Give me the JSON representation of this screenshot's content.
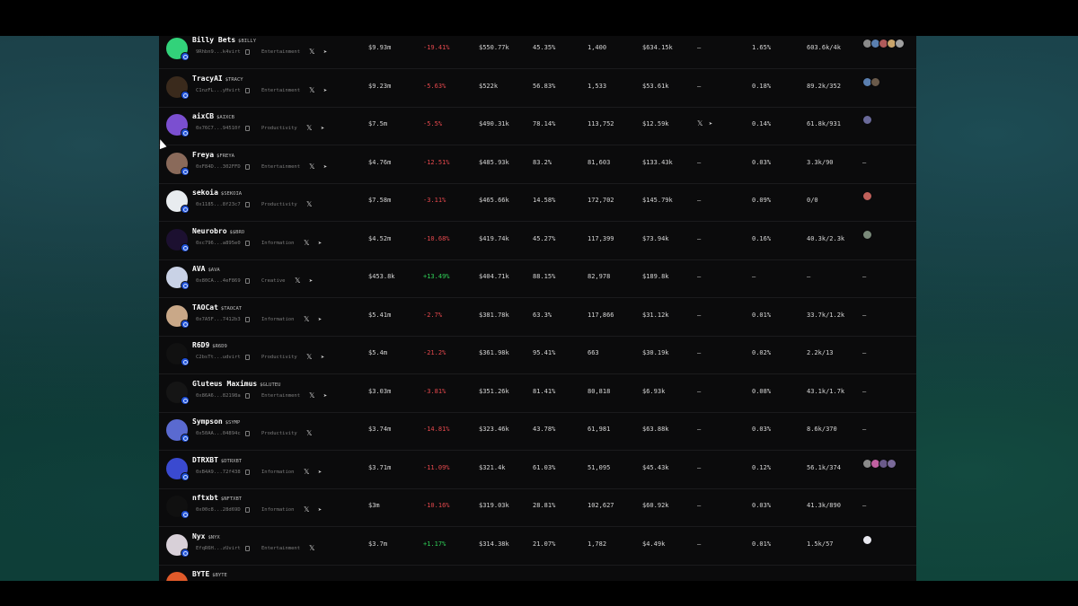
{
  "table": {
    "rows": [
      {
        "name": "Billy Bets",
        "ticker": "$BILLY",
        "address": "9Rhbn9...k4virt",
        "category": "Entertainment",
        "socials": [
          "x",
          "telegram"
        ],
        "mcap": "$9.93m",
        "change": "-19.41%",
        "change_dir": "neg",
        "col3": "$550.77k",
        "col4": "45.35%",
        "col5": "1,400",
        "col6": "$634.15k",
        "col7": "–",
        "col8": "1.65%",
        "col9": "603.6k/4k",
        "avatar_color": "#32d27a",
        "holder_avatars": [
          "#8a8a8a",
          "#5a7fb0",
          "#b05a5a",
          "#c9a46a",
          "#a0a0a0"
        ]
      },
      {
        "name": "TracyAI",
        "ticker": "$TRACY",
        "address": "C1nzFL...yHvirt",
        "category": "Entertainment",
        "socials": [
          "x",
          "telegram"
        ],
        "mcap": "$9.23m",
        "change": "-5.63%",
        "change_dir": "neg",
        "col3": "$522k",
        "col4": "56.83%",
        "col5": "1,533",
        "col6": "$53.61k",
        "col7": "–",
        "col8": "0.18%",
        "col9": "89.2k/352",
        "avatar_color": "#3a2a1c",
        "holder_avatars": [
          "#5a7fb0",
          "#6a5a4a"
        ]
      },
      {
        "name": "aixCB",
        "ticker": "$AIXCB",
        "address": "0x76C7...94510f",
        "category": "Productivity",
        "socials": [
          "x",
          "telegram"
        ],
        "mcap": "$7.5m",
        "change": "-5.5%",
        "change_dir": "neg",
        "col3": "$490.31k",
        "col4": "78.14%",
        "col5": "113,752",
        "col6": "$12.59k",
        "col7": "x-tg",
        "col8": "0.14%",
        "col9": "61.8k/931",
        "avatar_color": "#7b4fd0",
        "holder_avatars": [
          "#6a6a9a"
        ]
      },
      {
        "name": "Freya",
        "ticker": "$FREYA",
        "address": "0xF84D...302FFD",
        "category": "Entertainment",
        "socials": [
          "x",
          "telegram"
        ],
        "mcap": "$4.76m",
        "change": "-12.51%",
        "change_dir": "neg",
        "col3": "$485.93k",
        "col4": "83.2%",
        "col5": "81,603",
        "col6": "$133.43k",
        "col7": "–",
        "col8": "0.03%",
        "col9": "3.3k/90",
        "avatar_color": "#8a6a5a",
        "holder_avatars": [],
        "holders_text": "–"
      },
      {
        "name": "sekoia",
        "ticker": "$SEKOIA",
        "address": "0x1185...8f23c7",
        "category": "Productivity",
        "socials": [
          "x"
        ],
        "mcap": "$7.58m",
        "change": "-3.11%",
        "change_dir": "neg",
        "col3": "$465.66k",
        "col4": "14.58%",
        "col5": "172,702",
        "col6": "$145.79k",
        "col7": "–",
        "col8": "0.09%",
        "col9": "0/0",
        "avatar_color": "#e8ecef",
        "holder_avatars": [
          "#c0605a"
        ]
      },
      {
        "name": "Neurobro",
        "ticker": "$$BRO",
        "address": "0xc796...a895e0",
        "category": "Information",
        "socials": [
          "x",
          "telegram"
        ],
        "mcap": "$4.52m",
        "change": "-10.68%",
        "change_dir": "neg",
        "col3": "$419.74k",
        "col4": "45.27%",
        "col5": "117,399",
        "col6": "$73.94k",
        "col7": "–",
        "col8": "0.16%",
        "col9": "40.3k/2.3k",
        "avatar_color": "#1c1030",
        "holder_avatars": [
          "#7a8a7a"
        ]
      },
      {
        "name": "AVA",
        "ticker": "$AVA",
        "address": "0x80CA...4eF869",
        "category": "Creative",
        "socials": [
          "x",
          "telegram"
        ],
        "mcap": "$453.8k",
        "change": "+13.49%",
        "change_dir": "pos",
        "col3": "$404.71k",
        "col4": "88.15%",
        "col5": "82,978",
        "col6": "$189.8k",
        "col7": "–",
        "col8": "–",
        "col9": "–",
        "avatar_color": "#c9d2e6",
        "holder_avatars": [],
        "holders_text": "–"
      },
      {
        "name": "TAOCat",
        "ticker": "$TAOCAT",
        "address": "0x7A5F...7412b3",
        "category": "Information",
        "socials": [
          "x",
          "telegram"
        ],
        "mcap": "$5.41m",
        "change": "-2.7%",
        "change_dir": "neg",
        "col3": "$381.78k",
        "col4": "63.3%",
        "col5": "117,866",
        "col6": "$31.12k",
        "col7": "–",
        "col8": "0.01%",
        "col9": "33.7k/1.2k",
        "avatar_color": "#c9a888",
        "holder_avatars": [],
        "holders_text": "–"
      },
      {
        "name": "R6D9",
        "ticker": "$R6D9",
        "address": "C2bsTt...udvirt",
        "category": "Productivity",
        "socials": [
          "x",
          "telegram"
        ],
        "mcap": "$5.4m",
        "change": "-21.2%",
        "change_dir": "neg",
        "col3": "$361.98k",
        "col4": "95.41%",
        "col5": "663",
        "col6": "$30.19k",
        "col7": "–",
        "col8": "0.02%",
        "col9": "2.2k/13",
        "avatar_color": "#111111",
        "holder_avatars": [],
        "holders_text": "–"
      },
      {
        "name": "Gluteus Maximus",
        "ticker": "$GLUTEU",
        "address": "0x86A6...82198a",
        "category": "Entertainment",
        "socials": [
          "x",
          "telegram"
        ],
        "mcap": "$3.03m",
        "change": "-3.81%",
        "change_dir": "neg",
        "col3": "$351.26k",
        "col4": "81.41%",
        "col5": "80,818",
        "col6": "$6.93k",
        "col7": "–",
        "col8": "0.08%",
        "col9": "43.1k/1.7k",
        "avatar_color": "#151515",
        "holder_avatars": [],
        "holders_text": "–"
      },
      {
        "name": "Sympson",
        "ticker": "$SYMP",
        "address": "0x50AA...04894c",
        "category": "Productivity",
        "socials": [
          "x"
        ],
        "mcap": "$3.74m",
        "change": "-14.81%",
        "change_dir": "neg",
        "col3": "$323.46k",
        "col4": "43.78%",
        "col5": "61,981",
        "col6": "$63.88k",
        "col7": "–",
        "col8": "0.03%",
        "col9": "8.6k/370",
        "avatar_color": "#5a6ad0",
        "holder_avatars": [],
        "holders_text": "–"
      },
      {
        "name": "DTRXBT",
        "ticker": "$DTRXBT",
        "address": "0xB4A9...72f438",
        "category": "Information",
        "socials": [
          "x",
          "telegram"
        ],
        "mcap": "$3.71m",
        "change": "-11.09%",
        "change_dir": "neg",
        "col3": "$321.4k",
        "col4": "61.03%",
        "col5": "51,095",
        "col6": "$45.43k",
        "col7": "–",
        "col8": "0.12%",
        "col9": "56.1k/374",
        "avatar_color": "#3a4ad0",
        "holder_avatars": [
          "#8a8a8a",
          "#c060a0",
          "#6a5a8a",
          "#7a6a9a"
        ]
      },
      {
        "name": "nftxbt",
        "ticker": "$NFTXBT",
        "address": "0x00c8...28d69D",
        "category": "Information",
        "socials": [
          "x",
          "telegram"
        ],
        "mcap": "$3m",
        "change": "-10.16%",
        "change_dir": "neg",
        "col3": "$319.03k",
        "col4": "28.81%",
        "col5": "102,627",
        "col6": "$60.92k",
        "col7": "–",
        "col8": "0.03%",
        "col9": "41.3k/890",
        "avatar_color": "#101010",
        "holder_avatars": [],
        "holders_text": "–"
      },
      {
        "name": "Nyx",
        "ticker": "$NYX",
        "address": "EfqR6H...zUvirt",
        "category": "Entertainment",
        "socials": [
          "x"
        ],
        "mcap": "$3.7m",
        "change": "+1.17%",
        "change_dir": "pos",
        "col3": "$314.38k",
        "col4": "21.07%",
        "col5": "1,782",
        "col6": "$4.49k",
        "col7": "–",
        "col8": "0.01%",
        "col9": "1.5k/57",
        "avatar_color": "#d8d0d8",
        "holder_avatars": [
          "#e8e8ef"
        ]
      },
      {
        "name": "BYTE",
        "ticker": "$BYTE",
        "address": "",
        "category": "",
        "socials": [],
        "mcap": "",
        "change": "",
        "change_dir": "neg",
        "col3": "",
        "col4": "",
        "col5": "",
        "col6": "",
        "col7": "",
        "col8": "",
        "col9": "",
        "avatar_color": "#e05a2a",
        "holder_avatars": []
      }
    ]
  },
  "icons": {
    "x": "x-logo-icon",
    "telegram": "telegram-icon",
    "copy": "copy-icon",
    "chain": "chain-badge-icon"
  },
  "colors": {
    "negative": "#e5484d",
    "positive": "#30d158",
    "panel": "#0b0b0c"
  }
}
